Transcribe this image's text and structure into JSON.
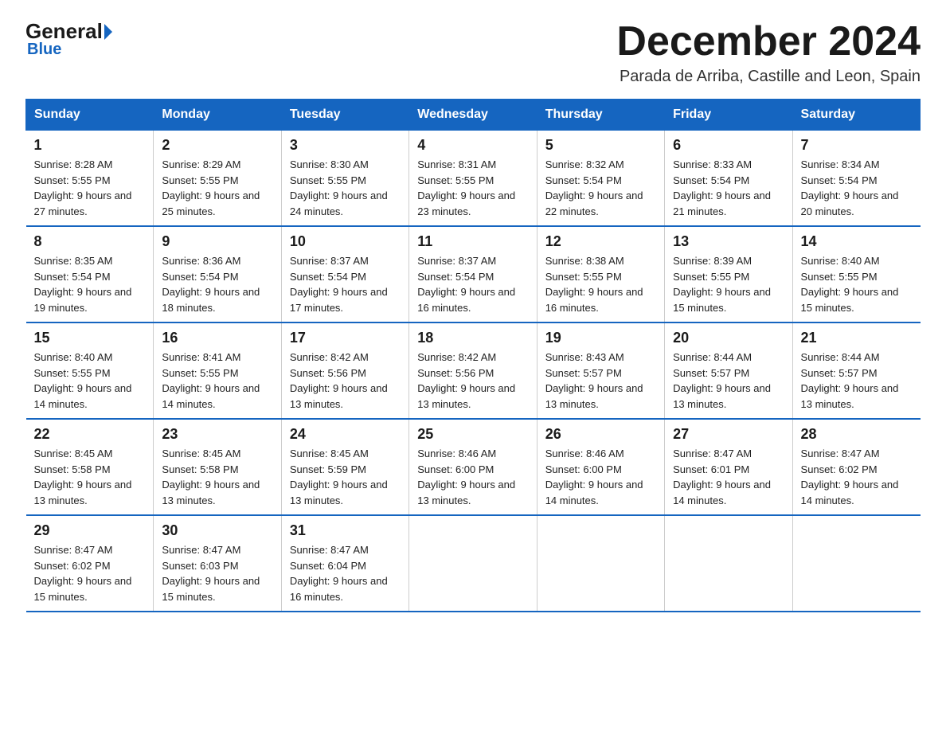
{
  "logo": {
    "general": "General",
    "triangle": "",
    "blue": "Blue"
  },
  "header": {
    "month": "December 2024",
    "location": "Parada de Arriba, Castille and Leon, Spain"
  },
  "weekdays": [
    "Sunday",
    "Monday",
    "Tuesday",
    "Wednesday",
    "Thursday",
    "Friday",
    "Saturday"
  ],
  "weeks": [
    [
      {
        "day": "1",
        "sunrise": "Sunrise: 8:28 AM",
        "sunset": "Sunset: 5:55 PM",
        "daylight": "Daylight: 9 hours and 27 minutes."
      },
      {
        "day": "2",
        "sunrise": "Sunrise: 8:29 AM",
        "sunset": "Sunset: 5:55 PM",
        "daylight": "Daylight: 9 hours and 25 minutes."
      },
      {
        "day": "3",
        "sunrise": "Sunrise: 8:30 AM",
        "sunset": "Sunset: 5:55 PM",
        "daylight": "Daylight: 9 hours and 24 minutes."
      },
      {
        "day": "4",
        "sunrise": "Sunrise: 8:31 AM",
        "sunset": "Sunset: 5:55 PM",
        "daylight": "Daylight: 9 hours and 23 minutes."
      },
      {
        "day": "5",
        "sunrise": "Sunrise: 8:32 AM",
        "sunset": "Sunset: 5:54 PM",
        "daylight": "Daylight: 9 hours and 22 minutes."
      },
      {
        "day": "6",
        "sunrise": "Sunrise: 8:33 AM",
        "sunset": "Sunset: 5:54 PM",
        "daylight": "Daylight: 9 hours and 21 minutes."
      },
      {
        "day": "7",
        "sunrise": "Sunrise: 8:34 AM",
        "sunset": "Sunset: 5:54 PM",
        "daylight": "Daylight: 9 hours and 20 minutes."
      }
    ],
    [
      {
        "day": "8",
        "sunrise": "Sunrise: 8:35 AM",
        "sunset": "Sunset: 5:54 PM",
        "daylight": "Daylight: 9 hours and 19 minutes."
      },
      {
        "day": "9",
        "sunrise": "Sunrise: 8:36 AM",
        "sunset": "Sunset: 5:54 PM",
        "daylight": "Daylight: 9 hours and 18 minutes."
      },
      {
        "day": "10",
        "sunrise": "Sunrise: 8:37 AM",
        "sunset": "Sunset: 5:54 PM",
        "daylight": "Daylight: 9 hours and 17 minutes."
      },
      {
        "day": "11",
        "sunrise": "Sunrise: 8:37 AM",
        "sunset": "Sunset: 5:54 PM",
        "daylight": "Daylight: 9 hours and 16 minutes."
      },
      {
        "day": "12",
        "sunrise": "Sunrise: 8:38 AM",
        "sunset": "Sunset: 5:55 PM",
        "daylight": "Daylight: 9 hours and 16 minutes."
      },
      {
        "day": "13",
        "sunrise": "Sunrise: 8:39 AM",
        "sunset": "Sunset: 5:55 PM",
        "daylight": "Daylight: 9 hours and 15 minutes."
      },
      {
        "day": "14",
        "sunrise": "Sunrise: 8:40 AM",
        "sunset": "Sunset: 5:55 PM",
        "daylight": "Daylight: 9 hours and 15 minutes."
      }
    ],
    [
      {
        "day": "15",
        "sunrise": "Sunrise: 8:40 AM",
        "sunset": "Sunset: 5:55 PM",
        "daylight": "Daylight: 9 hours and 14 minutes."
      },
      {
        "day": "16",
        "sunrise": "Sunrise: 8:41 AM",
        "sunset": "Sunset: 5:55 PM",
        "daylight": "Daylight: 9 hours and 14 minutes."
      },
      {
        "day": "17",
        "sunrise": "Sunrise: 8:42 AM",
        "sunset": "Sunset: 5:56 PM",
        "daylight": "Daylight: 9 hours and 13 minutes."
      },
      {
        "day": "18",
        "sunrise": "Sunrise: 8:42 AM",
        "sunset": "Sunset: 5:56 PM",
        "daylight": "Daylight: 9 hours and 13 minutes."
      },
      {
        "day": "19",
        "sunrise": "Sunrise: 8:43 AM",
        "sunset": "Sunset: 5:57 PM",
        "daylight": "Daylight: 9 hours and 13 minutes."
      },
      {
        "day": "20",
        "sunrise": "Sunrise: 8:44 AM",
        "sunset": "Sunset: 5:57 PM",
        "daylight": "Daylight: 9 hours and 13 minutes."
      },
      {
        "day": "21",
        "sunrise": "Sunrise: 8:44 AM",
        "sunset": "Sunset: 5:57 PM",
        "daylight": "Daylight: 9 hours and 13 minutes."
      }
    ],
    [
      {
        "day": "22",
        "sunrise": "Sunrise: 8:45 AM",
        "sunset": "Sunset: 5:58 PM",
        "daylight": "Daylight: 9 hours and 13 minutes."
      },
      {
        "day": "23",
        "sunrise": "Sunrise: 8:45 AM",
        "sunset": "Sunset: 5:58 PM",
        "daylight": "Daylight: 9 hours and 13 minutes."
      },
      {
        "day": "24",
        "sunrise": "Sunrise: 8:45 AM",
        "sunset": "Sunset: 5:59 PM",
        "daylight": "Daylight: 9 hours and 13 minutes."
      },
      {
        "day": "25",
        "sunrise": "Sunrise: 8:46 AM",
        "sunset": "Sunset: 6:00 PM",
        "daylight": "Daylight: 9 hours and 13 minutes."
      },
      {
        "day": "26",
        "sunrise": "Sunrise: 8:46 AM",
        "sunset": "Sunset: 6:00 PM",
        "daylight": "Daylight: 9 hours and 14 minutes."
      },
      {
        "day": "27",
        "sunrise": "Sunrise: 8:47 AM",
        "sunset": "Sunset: 6:01 PM",
        "daylight": "Daylight: 9 hours and 14 minutes."
      },
      {
        "day": "28",
        "sunrise": "Sunrise: 8:47 AM",
        "sunset": "Sunset: 6:02 PM",
        "daylight": "Daylight: 9 hours and 14 minutes."
      }
    ],
    [
      {
        "day": "29",
        "sunrise": "Sunrise: 8:47 AM",
        "sunset": "Sunset: 6:02 PM",
        "daylight": "Daylight: 9 hours and 15 minutes."
      },
      {
        "day": "30",
        "sunrise": "Sunrise: 8:47 AM",
        "sunset": "Sunset: 6:03 PM",
        "daylight": "Daylight: 9 hours and 15 minutes."
      },
      {
        "day": "31",
        "sunrise": "Sunrise: 8:47 AM",
        "sunset": "Sunset: 6:04 PM",
        "daylight": "Daylight: 9 hours and 16 minutes."
      },
      {
        "day": "",
        "sunrise": "",
        "sunset": "",
        "daylight": ""
      },
      {
        "day": "",
        "sunrise": "",
        "sunset": "",
        "daylight": ""
      },
      {
        "day": "",
        "sunrise": "",
        "sunset": "",
        "daylight": ""
      },
      {
        "day": "",
        "sunrise": "",
        "sunset": "",
        "daylight": ""
      }
    ]
  ]
}
